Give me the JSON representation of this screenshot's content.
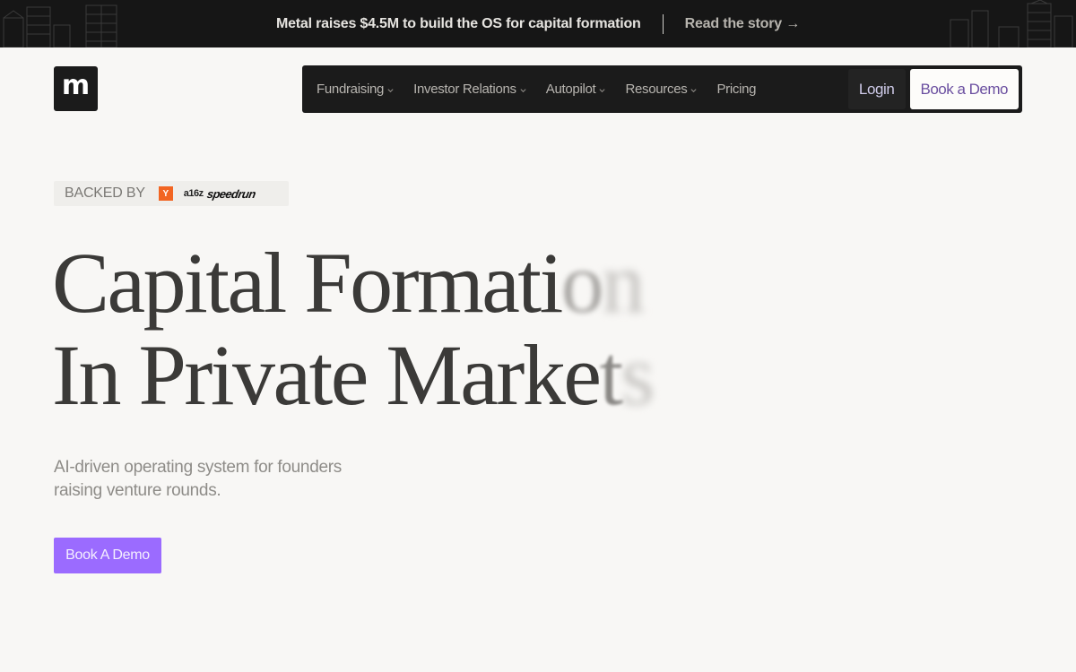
{
  "announcement": {
    "text": "Metal raises $4.5M to build the OS for capital formation",
    "link_label": "Read the story",
    "link_arrow": "→"
  },
  "logo": {
    "letter": "m"
  },
  "nav": {
    "items": [
      {
        "label": "Fundraising",
        "has_dropdown": true
      },
      {
        "label": "Investor Relations",
        "has_dropdown": true
      },
      {
        "label": "Autopilot",
        "has_dropdown": true
      },
      {
        "label": "Resources",
        "has_dropdown": true
      },
      {
        "label": "Pricing",
        "has_dropdown": false
      }
    ],
    "login_label": "Login",
    "demo_label": "Book a Demo"
  },
  "backed": {
    "label": "BACKED BY",
    "yc_letter": "Y",
    "a16z": "a16z",
    "speedrun": "speedrun"
  },
  "hero": {
    "line1_main": "Capital Formati",
    "line1_fade1": "o",
    "line1_fade2": "n",
    "line2_main": "In Private Marke",
    "line2_fade1": "t",
    "line2_fade2": "s",
    "subtitle_line1": "AI-driven operating system for founders",
    "subtitle_line2": "raising venture rounds.",
    "cta_label": "Book A Demo"
  },
  "colors": {
    "page_bg": "#f8f7f5",
    "dark": "#1b1b1b",
    "accent": "#9b6bff",
    "demo_text": "#6b4fa0"
  }
}
